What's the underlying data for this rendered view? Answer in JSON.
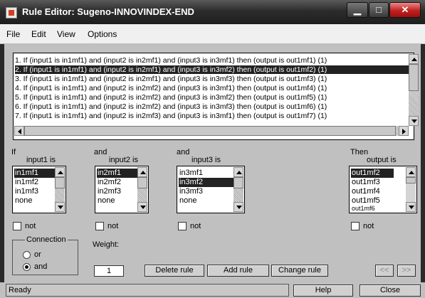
{
  "window": {
    "title": "Rule Editor: Sugeno-INNOVINDEX-END",
    "minimize": "▁",
    "maximize": "□",
    "close": "✕"
  },
  "menu": {
    "file": "File",
    "edit": "Edit",
    "view": "View",
    "options": "Options"
  },
  "rules": [
    "1. If (input1 is in1mf1) and (input2 is in2mf1) and (input3 is in3mf1) then (output is out1mf1) (1)",
    "2. If (input1 is in1mf1) and (input2 is in2mf1) and (input3 is in3mf2) then (output is out1mf2) (1)",
    "3. If (input1 is in1mf1) and (input2 is in2mf1) and (input3 is in3mf3) then (output is out1mf3) (1)",
    "4. If (input1 is in1mf1) and (input2 is in2mf2) and (input3 is in3mf1) then (output is out1mf4) (1)",
    "5. If (input1 is in1mf1) and (input2 is in2mf2) and (input3 is in3mf2) then (output is out1mf5) (1)",
    "6. If (input1 is in1mf1) and (input2 is in2mf2) and (input3 is in3mf3) then (output is out1mf6) (1)",
    "7. If (input1 is in1mf1) and (input2 is in2mf3) and (input3 is in3mf1) then (output is out1mf7) (1)"
  ],
  "selected_rule": 2,
  "input1": {
    "prefix": "If",
    "label": "input1 is",
    "items": [
      "in1mf1",
      "in1mf2",
      "in1mf3",
      "none"
    ],
    "selected": "in1mf1"
  },
  "input2": {
    "prefix": "and",
    "label": "input2 is",
    "items": [
      "in2mf1",
      "in2mf2",
      "in2mf3",
      "none"
    ],
    "selected": "in2mf1"
  },
  "input3": {
    "prefix": "and",
    "label": "input3 is",
    "items": [
      "in3mf1",
      "in3mf2",
      "in3mf3",
      "none"
    ],
    "selected": "in3mf2"
  },
  "output": {
    "prefix": "Then",
    "label": "output is",
    "items": [
      "out1mf2",
      "out1mf3",
      "out1mf4",
      "out1mf5",
      "out1mf6"
    ],
    "selected": "out1mf2"
  },
  "not_label": "not",
  "connection": {
    "label": "Connection",
    "or": "or",
    "and": "and",
    "selected": "and"
  },
  "weight": {
    "label": "Weight:",
    "value": "1"
  },
  "buttons": {
    "delete": "Delete rule",
    "add": "Add rule",
    "change": "Change rule",
    "prev": "<<",
    "next": ">>"
  },
  "status": {
    "text": "Ready",
    "help": "Help",
    "close": "Close"
  }
}
